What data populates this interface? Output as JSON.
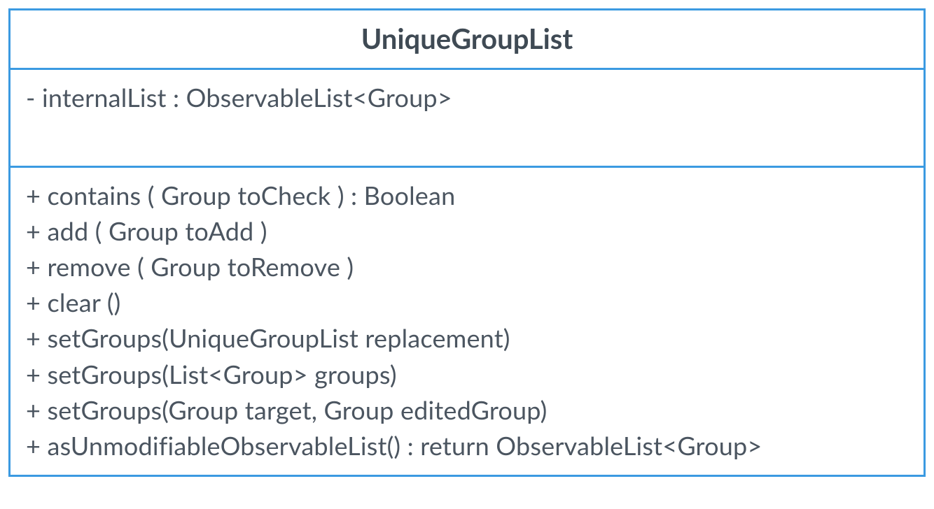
{
  "class": {
    "name": "UniqueGroupList",
    "attributes": [
      "- internalList : ObservableList<Group>"
    ],
    "methods": [
      "+ contains ( Group toCheck ) : Boolean",
      "+ add ( Group toAdd )",
      "+ remove ( Group toRemove )",
      "+ clear ()",
      "+ setGroups(UniqueGroupList replacement)",
      "+ setGroups(List<Group> groups)",
      "+ setGroups(Group target, Group editedGroup)",
      "+ asUnmodifiableObservableList() : return ObservableList<Group>"
    ]
  }
}
